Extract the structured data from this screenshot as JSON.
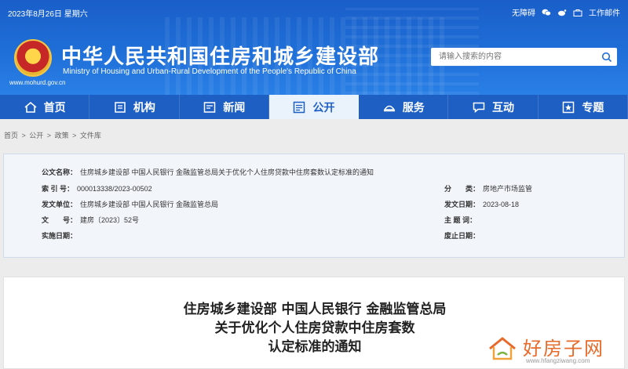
{
  "header": {
    "date": "2023年8月26日 星期六",
    "accessibility_label": "无障碍",
    "work_portal_label": "工作邮件",
    "title": "中华人民共和国住房和城乡建设部",
    "subtitle": "Ministry of Housing and Urban-Rural Development of the People's Republic of China",
    "url": "www.mohurd.gov.cn",
    "search_placeholder": "请输入搜索的内容"
  },
  "nav": {
    "items": [
      {
        "label": "首页",
        "icon": "home-icon"
      },
      {
        "label": "机构",
        "icon": "building-icon"
      },
      {
        "label": "新闻",
        "icon": "news-icon"
      },
      {
        "label": "公开",
        "icon": "public-icon"
      },
      {
        "label": "服务",
        "icon": "service-icon"
      },
      {
        "label": "互动",
        "icon": "chat-icon"
      },
      {
        "label": "专题",
        "icon": "topic-icon"
      }
    ],
    "active_index": 3
  },
  "breadcrumb": [
    "首页",
    "公开",
    "政策",
    "文件库"
  ],
  "meta": {
    "index_name_label": "公文名称：",
    "index_name_value": "住房城乡建设部 中国人民银行 金融监管总局关于优化个人住房贷款中住房套数认定标准的通知",
    "index_no_label": "索 引 号：",
    "index_no_value": "000013338/2023-00502",
    "category_label": "分　　类：",
    "category_value": "房地产市场监管",
    "issuer_label": "发文单位：",
    "issuer_value": "住房城乡建设部 中国人民银行 金融监管总局",
    "issue_date_label": "发文日期：",
    "issue_date_value": "2023-08-18",
    "doc_no_label": "文　　号：",
    "doc_no_value": "建房〔2023〕52号",
    "subject_label": "主 题 词：",
    "subject_value": "",
    "effective_label": "实施日期：",
    "effective_value": "",
    "expire_label": "废止日期：",
    "expire_value": ""
  },
  "article": {
    "title_line1": "住房城乡建设部 中国人民银行 金融监管总局",
    "title_line2": "关于优化个人住房贷款中住房套数",
    "title_line3": "认定标准的通知"
  },
  "watermark": {
    "text": "好房子网",
    "url": "www.hfangziwang.com"
  },
  "colors": {
    "header_blue": "#1f6fd8",
    "nav_blue": "#1e5fc4",
    "active_tab_bg": "#eaf2fc"
  }
}
